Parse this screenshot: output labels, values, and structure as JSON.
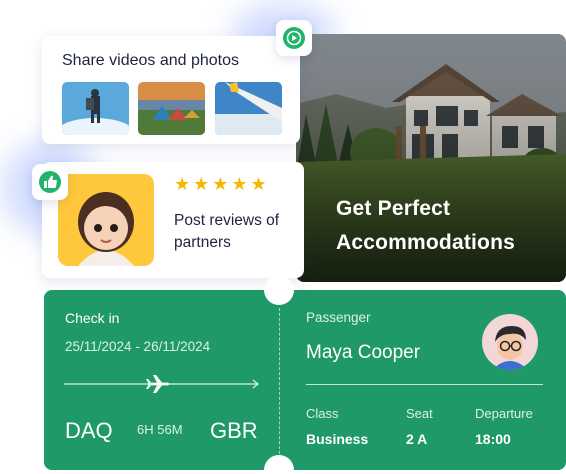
{
  "share": {
    "title": "Share videos and photos",
    "badge_icon": "play-circle-icon",
    "thumbnails": [
      "hiker-photo",
      "camping-tents-photo",
      "airplane-wing-photo"
    ]
  },
  "review": {
    "badge_icon": "thumbs-up-icon",
    "stars": "★★★★★",
    "text": "Post reviews of partners"
  },
  "accommodation": {
    "line1": "Get Perfect",
    "line2": "Accommodations"
  },
  "ticket": {
    "check_in_label": "Check in",
    "dates": "25/11/2024 - 26/11/2024",
    "from": "DAQ",
    "duration": "6H 56M",
    "to": "GBR",
    "passenger_label": "Passenger",
    "passenger_name": "Maya Cooper",
    "class_label": "Class",
    "class_value": "Business",
    "seat_label": "Seat",
    "seat_value": "2 A",
    "departure_label": "Departure",
    "departure_value": "18:00"
  },
  "colors": {
    "ticket_green": "#1f9968",
    "star": "#f5b800",
    "badge_green": "#21b36b"
  }
}
